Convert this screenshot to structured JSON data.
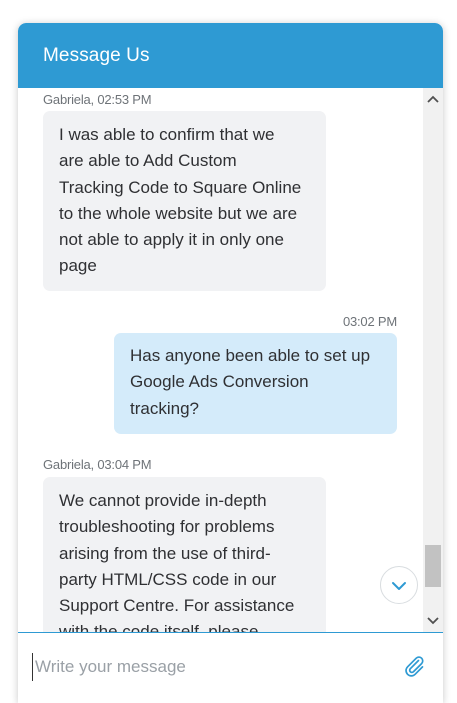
{
  "header": {
    "title": "Message Us"
  },
  "messages": [
    {
      "author": "agent",
      "meta": "Gabriela, 02:53 PM",
      "text": "I was able to confirm that  we\nare able to  Add Custom\nTracking Code to Square Online\nto the whole website but we are\nnot able to apply it in only one\npage"
    },
    {
      "author": "user",
      "meta": "03:02 PM",
      "text": "Has anyone been able to set up\nGoogle Ads Conversion\ntracking?"
    },
    {
      "author": "agent",
      "meta": "Gabriela, 03:04 PM",
      "text": "We cannot provide in-depth\ntroubleshooting for problems\narising from the use of third-\nparty HTML/CSS code in our\nSupport Centre. For assistance\nwith the code itself, please"
    }
  ],
  "composer": {
    "placeholder": "Write your message"
  },
  "icons": {
    "scroll_up": "chevron-up-icon",
    "scroll_down": "chevron-down-icon",
    "jump_down": "chevron-down-icon",
    "attach": "paperclip-icon"
  },
  "colors": {
    "brand": "#2e9ad3",
    "agent_bubble": "#f1f2f4",
    "user_bubble": "#d4ebfa"
  }
}
